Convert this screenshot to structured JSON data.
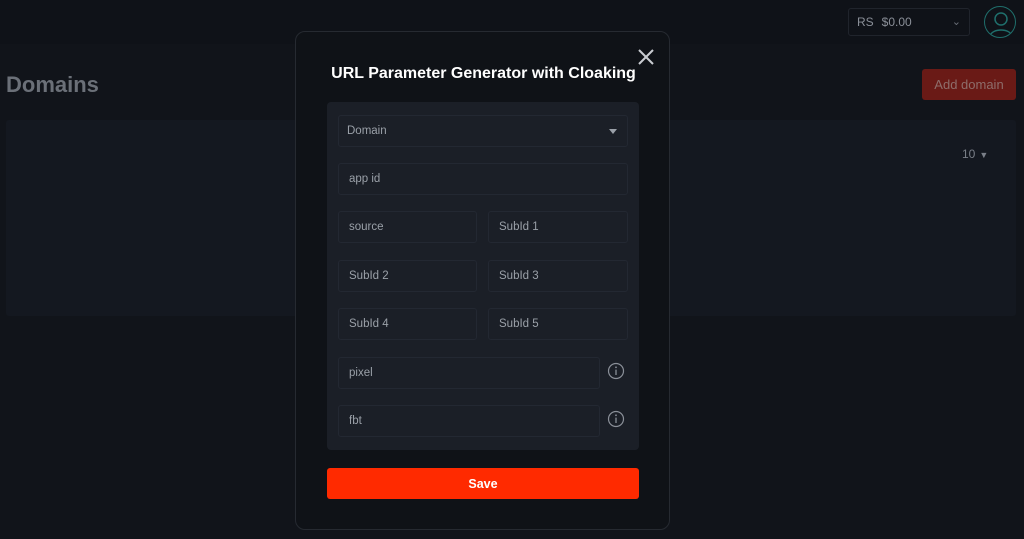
{
  "topbar": {
    "currency_symbol": "RS",
    "balance": "$0.00"
  },
  "page": {
    "title": "Domains",
    "add_button_label": "Add domain",
    "per_page": "10"
  },
  "modal": {
    "title": "URL Parameter Generator with Cloaking",
    "domain_select": "Domain",
    "app_id_placeholder": "app id",
    "source_placeholder": "source",
    "subid1_placeholder": "SubId 1",
    "subid2_placeholder": "SubId 2",
    "subid3_placeholder": "SubId 3",
    "subid4_placeholder": "SubId 4",
    "subid5_placeholder": "SubId 5",
    "pixel_placeholder": "pixel",
    "fbt_placeholder": "fbt",
    "save_label": "Save"
  },
  "colors": {
    "accent": "#ff2a00",
    "background": "#11141a",
    "modal_bg": "#0f1217",
    "panel_bg": "#1b1f27"
  },
  "icons": {
    "close": "close-icon",
    "info": "info-icon",
    "user": "user-icon",
    "dropdown": "chevron-down-icon"
  }
}
